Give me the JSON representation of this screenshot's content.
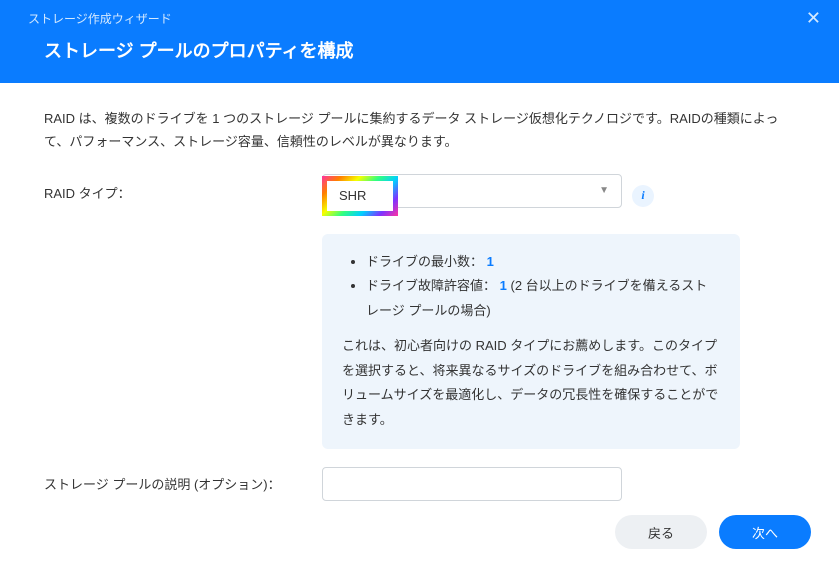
{
  "header": {
    "breadcrumb": "ストレージ作成ウィザード",
    "title": "ストレージ プールのプロパティを構成"
  },
  "intro": "RAID は、複数のドライブを 1 つのストレージ プールに集約するデータ ストレージ仮想化テクノロジです。RAIDの種類によって、パフォーマンス、ストレージ容量、信頼性のレベルが異なります。",
  "raidType": {
    "label": "RAID タイプ：",
    "value": "SHR"
  },
  "infoPanel": {
    "minDrivesLabel": "ドライブの最小数：",
    "minDrivesValue": "1",
    "faultToleranceLabel": "ドライブ故障許容値：",
    "faultToleranceValue": "1",
    "faultToleranceNote": " (2 台以上のドライブを備えるストレージ プールの場合)",
    "description": "これは、初心者向けの RAID タイプにお薦めします。このタイプを選択すると、将来異なるサイズのドライブを組み合わせて、ボリュームサイズを最適化し、データの冗長性を確保することができます。"
  },
  "description": {
    "label": "ストレージ プールの説明 (オプション)："
  },
  "footer": {
    "back": "戻る",
    "next": "次へ"
  }
}
